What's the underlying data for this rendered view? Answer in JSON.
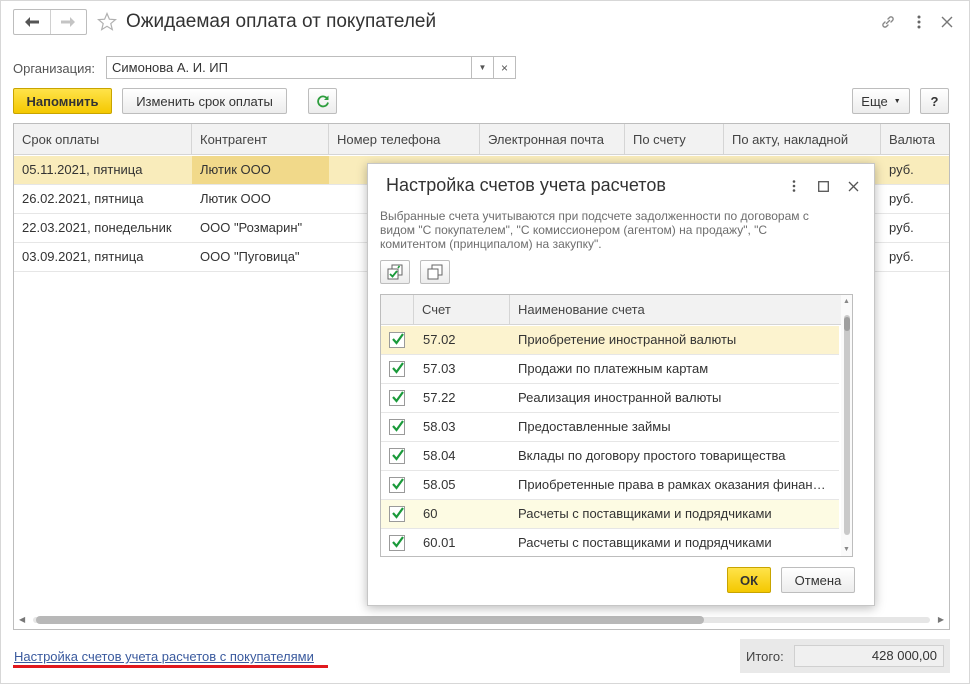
{
  "window": {
    "title": "Ожидаемая оплата от покупателей"
  },
  "filter": {
    "org_label": "Организация:",
    "org_value": "Симонова А. И. ИП"
  },
  "toolbar": {
    "remind_label": "Напомнить",
    "change_term_label": "Изменить срок оплаты",
    "more_label": "Еще",
    "help_label": "?"
  },
  "table": {
    "columns": [
      "Срок оплаты",
      "Контрагент",
      "Номер телефона",
      "Электронная почта",
      "По счету",
      "По акту, накладной",
      "Валюта"
    ],
    "rows": [
      {
        "date": "05.11.2021, пятница",
        "contractor": "Лютик ООО",
        "currency": "руб."
      },
      {
        "date": "26.02.2021, пятница",
        "contractor": "Лютик ООО",
        "currency": "руб."
      },
      {
        "date": "22.03.2021, понедельник",
        "contractor": "ООО \"Розмарин\"",
        "currency": "руб."
      },
      {
        "date": "03.09.2021, пятница",
        "contractor": "ООО \"Пуговица\"",
        "currency": "руб."
      }
    ]
  },
  "footer": {
    "settings_link": "Настройка счетов учета расчетов с покупателями",
    "total_label": "Итого:",
    "total_value": "428 000,00"
  },
  "dialog": {
    "title": "Настройка счетов учета расчетов",
    "note": "Выбранные счета учитываются при подсчете задолженности по договорам с видом \"С покупателем\", \"С комиссионером (агентом) на продажу\", \"С комитентом (принципалом) на закупку\".",
    "columns": [
      "Счет",
      "Наименование счета"
    ],
    "rows": [
      {
        "code": "57.02",
        "name": "Приобретение иностранной валюты",
        "checked": true
      },
      {
        "code": "57.03",
        "name": "Продажи по платежным картам",
        "checked": true
      },
      {
        "code": "57.22",
        "name": "Реализация иностранной валюты",
        "checked": true
      },
      {
        "code": "58.03",
        "name": "Предоставленные займы",
        "checked": true
      },
      {
        "code": "58.04",
        "name": "Вклады по договору простого товарищества",
        "checked": true
      },
      {
        "code": "58.05",
        "name": "Приобретенные права в рамках оказания финансовых услуг",
        "checked": true
      },
      {
        "code": "60",
        "name": "Расчеты с поставщиками и подрядчиками",
        "checked": true
      },
      {
        "code": "60.01",
        "name": "Расчеты с поставщиками и подрядчиками",
        "checked": true
      }
    ],
    "ok_label": "ОК",
    "cancel_label": "Отмена"
  },
  "colors": {
    "accent_yellow": "#f4c800",
    "selected_row": "#f9ecbb",
    "check_green": "#1a9a3a",
    "link_blue": "#3a5a9e",
    "underline_red": "#e0191e"
  }
}
